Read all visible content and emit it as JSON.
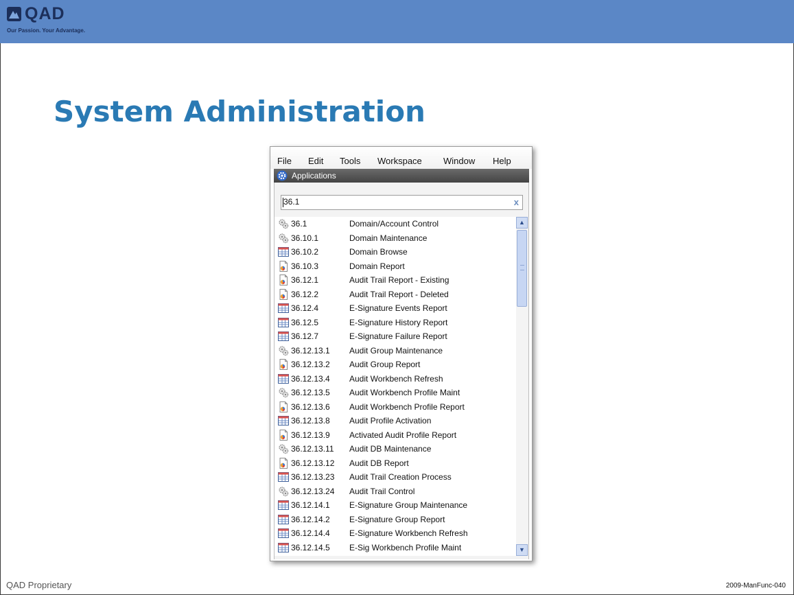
{
  "branding": {
    "logo_text": "QAD",
    "tagline": "Our Passion. Your Advantage."
  },
  "slide": {
    "title": "System Administration",
    "footer_left": "QAD Proprietary",
    "footer_right": "2009-ManFunc-040"
  },
  "menu": [
    "File",
    "Edit",
    "Tools",
    "Workspace",
    "Window",
    "Help"
  ],
  "panel": {
    "title": "Applications"
  },
  "search": {
    "value": "36.1",
    "clear_icon": "x"
  },
  "rows": [
    {
      "code": "36.1",
      "desc": "Domain/Account Control",
      "icon": "gear-icon"
    },
    {
      "code": "36.10.1",
      "desc": "Domain Maintenance",
      "icon": "gear-icon"
    },
    {
      "code": "36.10.2",
      "desc": "Domain Browse",
      "icon": "browse-icon"
    },
    {
      "code": "36.10.3",
      "desc": "Domain Report",
      "icon": "report-icon"
    },
    {
      "code": "36.12.1",
      "desc": "Audit Trail Report - Existing",
      "icon": "report-icon"
    },
    {
      "code": "36.12.2",
      "desc": "Audit Trail Report - Deleted",
      "icon": "report-icon"
    },
    {
      "code": "36.12.4",
      "desc": "E-Signature Events Report",
      "icon": "browse-icon"
    },
    {
      "code": "36.12.5",
      "desc": "E-Signature History Report",
      "icon": "browse-icon"
    },
    {
      "code": "36.12.7",
      "desc": "E-Signature Failure Report",
      "icon": "browse-icon"
    },
    {
      "code": "36.12.13.1",
      "desc": "Audit Group Maintenance",
      "icon": "gear-icon"
    },
    {
      "code": "36.12.13.2",
      "desc": "Audit Group Report",
      "icon": "report-icon"
    },
    {
      "code": "36.12.13.4",
      "desc": "Audit Workbench Refresh",
      "icon": "browse-icon"
    },
    {
      "code": "36.12.13.5",
      "desc": "Audit Workbench Profile Maint",
      "icon": "gear-icon"
    },
    {
      "code": "36.12.13.6",
      "desc": "Audit Workbench Profile Report",
      "icon": "report-icon"
    },
    {
      "code": "36.12.13.8",
      "desc": "Audit Profile Activation",
      "icon": "browse-icon"
    },
    {
      "code": "36.12.13.9",
      "desc": "Activated Audit Profile Report",
      "icon": "report-icon"
    },
    {
      "code": "36.12.13.11",
      "desc": "Audit DB Maintenance",
      "icon": "gear-icon"
    },
    {
      "code": "36.12.13.12",
      "desc": "Audit DB Report",
      "icon": "report-icon"
    },
    {
      "code": "36.12.13.23",
      "desc": "Audit Trail Creation Process",
      "icon": "browse-icon"
    },
    {
      "code": "36.12.13.24",
      "desc": "Audit Trail Control",
      "icon": "gear-icon"
    },
    {
      "code": "36.12.14.1",
      "desc": "E-Signature Group Maintenance",
      "icon": "browse-icon"
    },
    {
      "code": "36.12.14.2",
      "desc": "E-Signature Group Report",
      "icon": "browse-icon"
    },
    {
      "code": "36.12.14.4",
      "desc": "E-Signature Workbench Refresh",
      "icon": "browse-icon"
    },
    {
      "code": "36.12.14.5",
      "desc": "E-Sig Workbench Profile Maint",
      "icon": "browse-icon"
    }
  ]
}
